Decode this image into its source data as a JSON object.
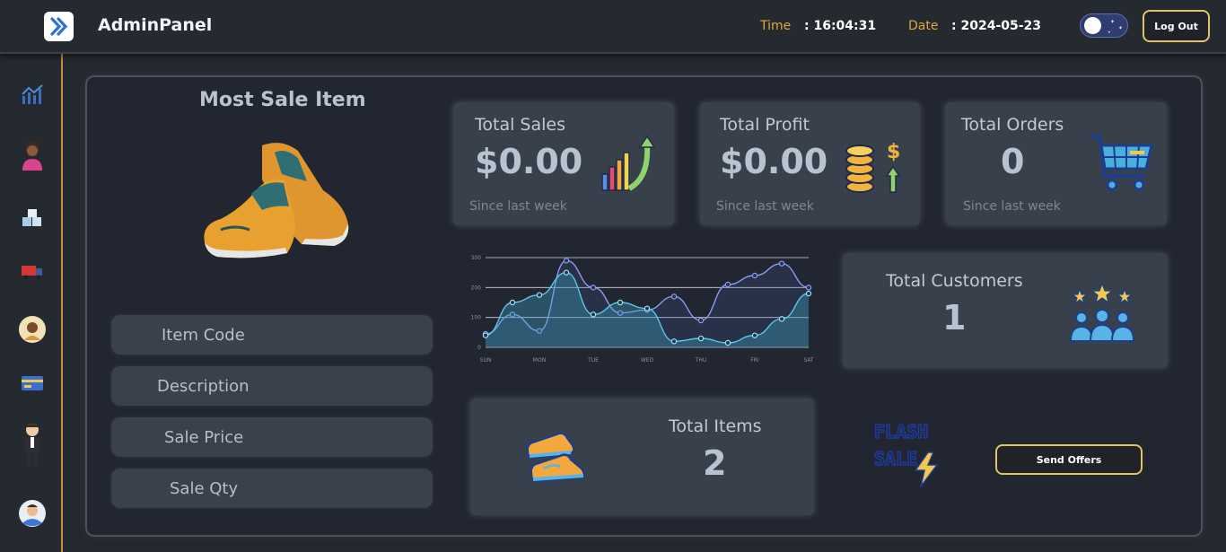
{
  "header": {
    "brand": "AdminPanel",
    "time_label": "Time :",
    "time_value": ": 16:04:31",
    "date_label": "Date :",
    "date_value": ": 2024-05-23",
    "logout_label": "Log Out"
  },
  "sidebar": {
    "items": [
      {
        "icon": "line-chart-icon"
      },
      {
        "icon": "customer-avatar-icon"
      },
      {
        "icon": "boxes-icon"
      },
      {
        "icon": "delivery-truck-icon"
      },
      {
        "icon": "supplier-avatar-icon"
      },
      {
        "icon": "credit-card-icon"
      },
      {
        "icon": "employee-icon"
      },
      {
        "icon": "user-profile-icon"
      }
    ]
  },
  "most_sale": {
    "title": "Most Sale Item",
    "fields": [
      "Item Code",
      "Description",
      "Sale Price",
      "Sale Qty"
    ]
  },
  "cards": {
    "total_sales": {
      "title": "Total Sales",
      "value": "$0.00",
      "since": "Since last week"
    },
    "total_profit": {
      "title": "Total Profit",
      "value": "$0.00",
      "since": "Since last week"
    },
    "total_orders": {
      "title": "Total Orders",
      "value": "0",
      "since": "Since last week"
    },
    "total_customers": {
      "title": "Total Customers",
      "value": "1"
    },
    "total_items": {
      "title": "Total Items",
      "value": "2"
    }
  },
  "chart_data": {
    "type": "area",
    "categories": [
      "SUN",
      "MON",
      "TUE",
      "WED",
      "THU",
      "FRI",
      "SAT"
    ],
    "y_ticks": [
      "300",
      "200",
      "100",
      "0"
    ],
    "ylim": [
      0,
      300
    ],
    "series": [
      {
        "values": [
          45,
          110,
          55,
          290,
          200,
          115,
          125,
          170,
          90,
          210,
          240,
          280,
          200
        ]
      },
      {
        "values": [
          40,
          150,
          175,
          250,
          110,
          150,
          130,
          20,
          30,
          15,
          40,
          95,
          180
        ]
      }
    ],
    "colors": {
      "line": "#8a9cf0",
      "area": "#59c6e6",
      "fill": "#1f4e63"
    }
  },
  "offers": {
    "button_label": "Send Offers",
    "flash_line1": "FLASH",
    "flash_line2": "SALE"
  }
}
